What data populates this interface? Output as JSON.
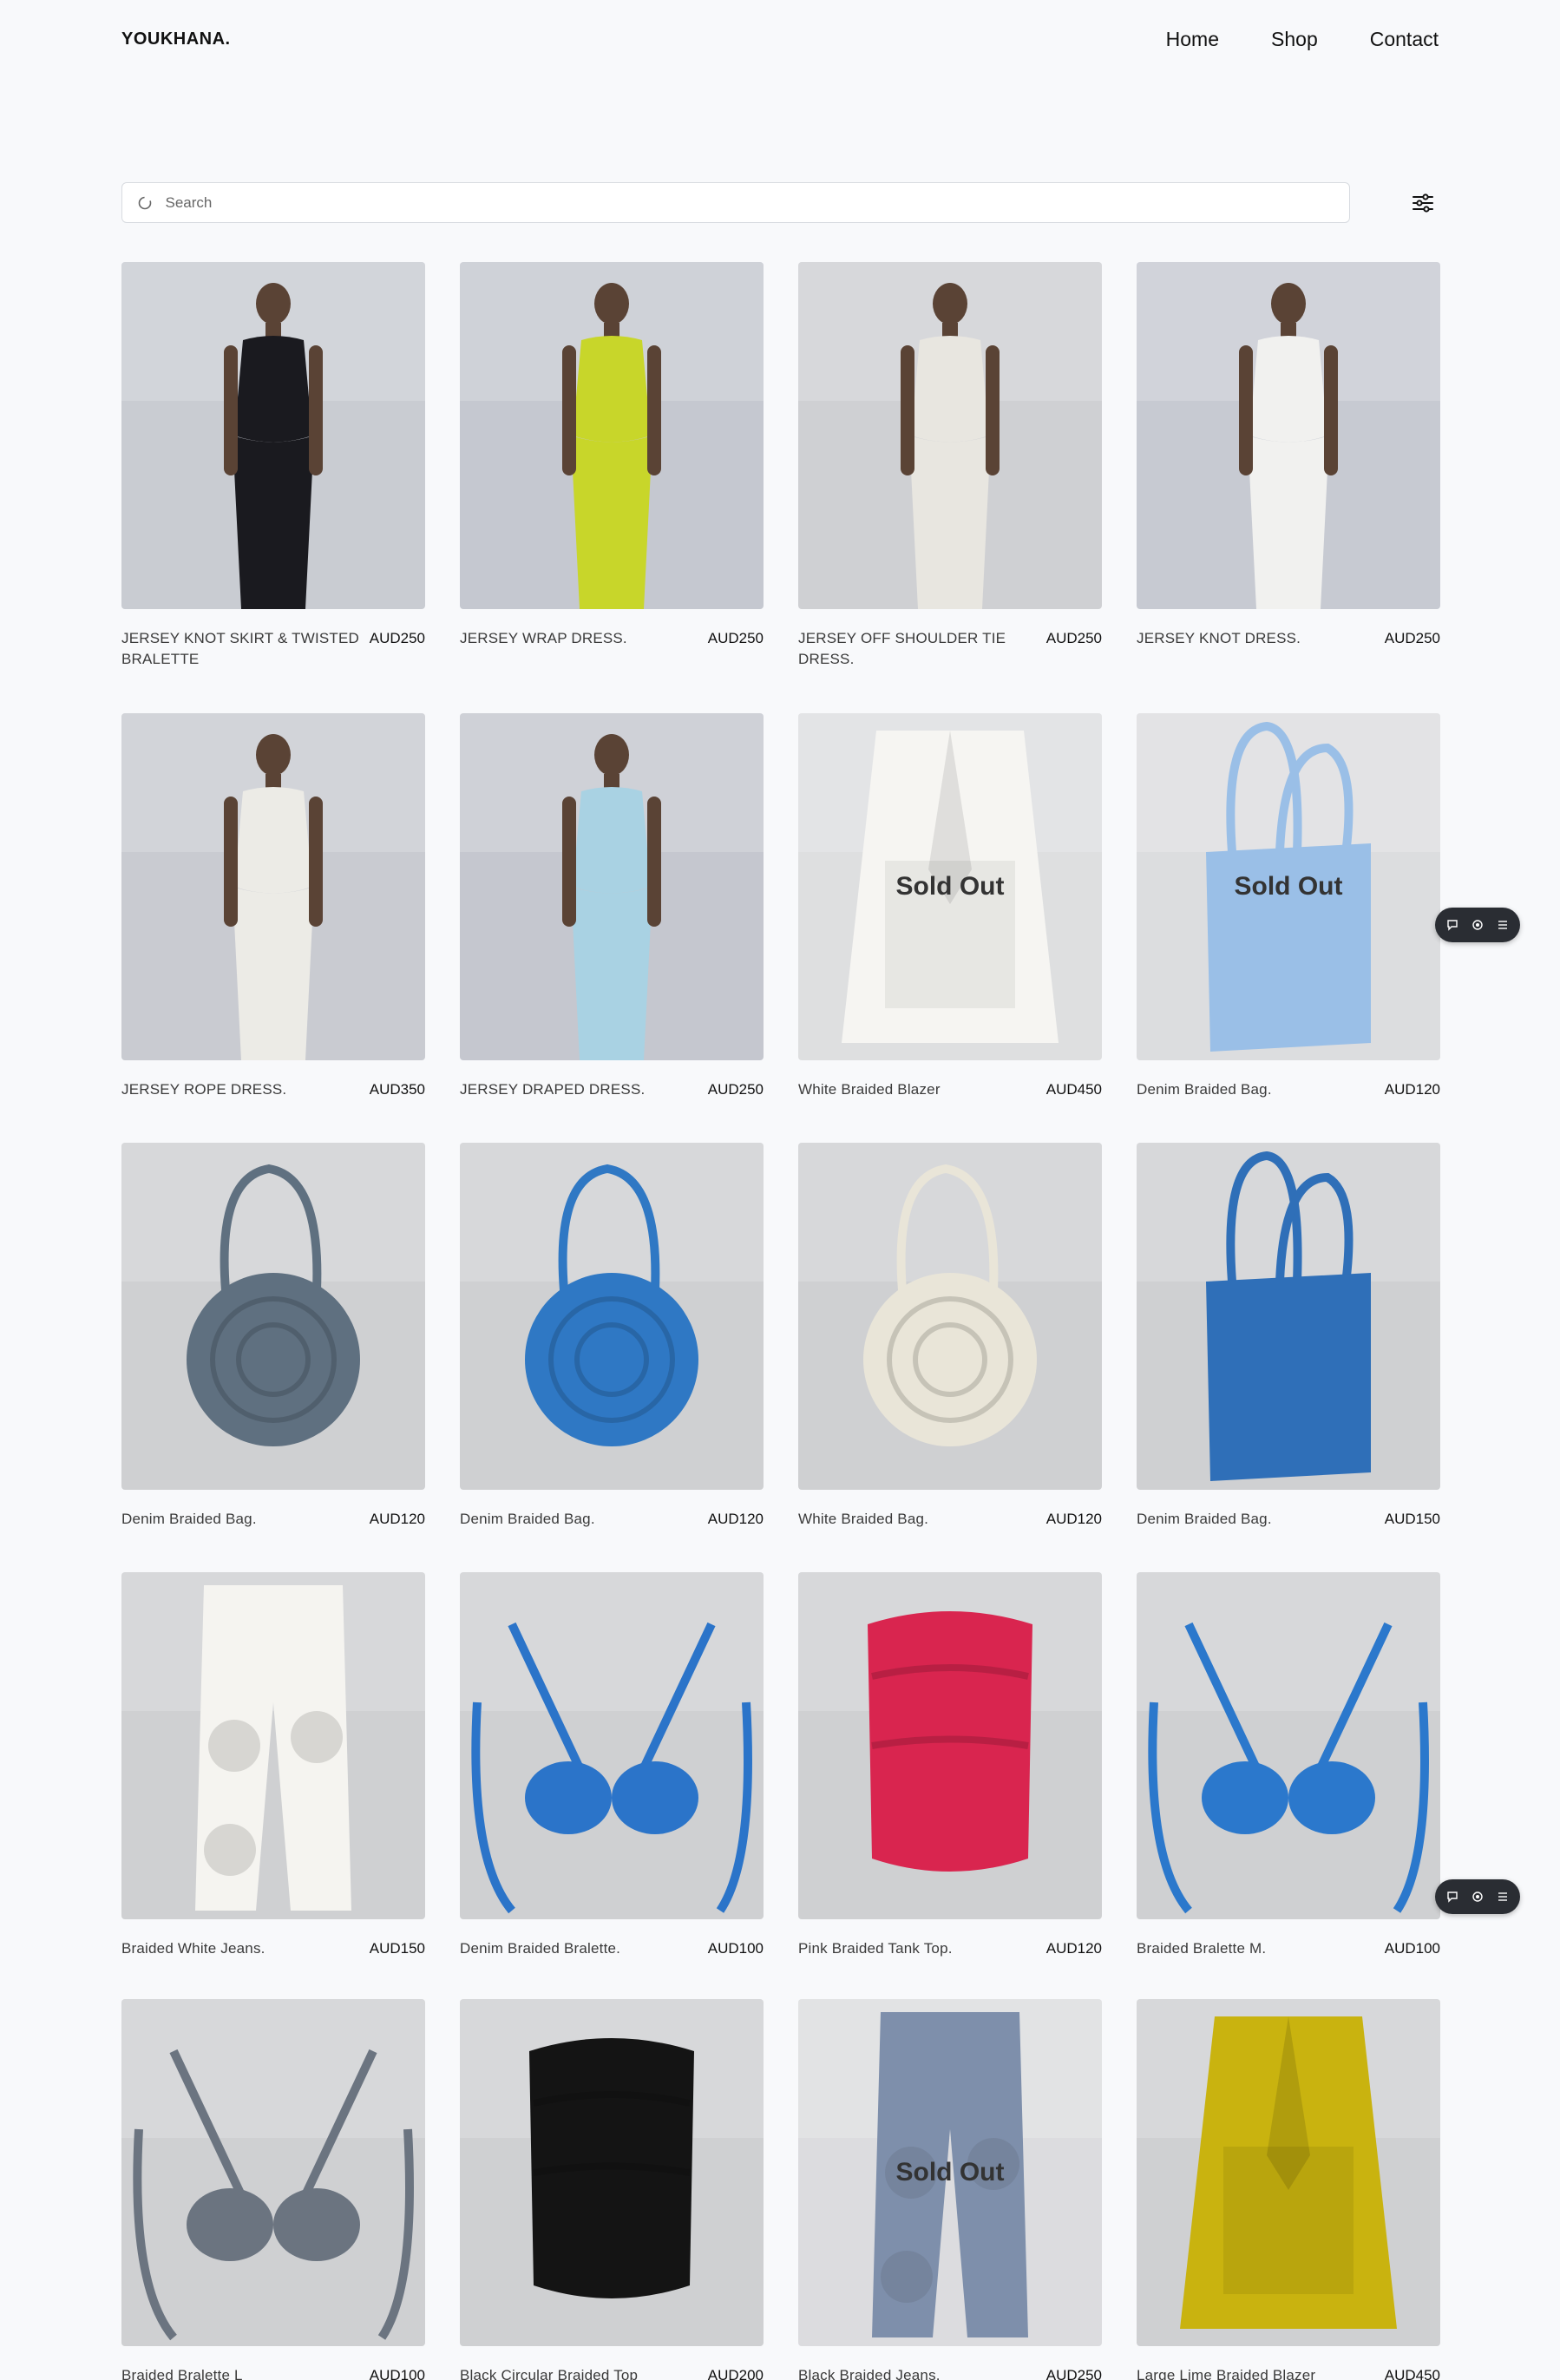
{
  "brand": "YOUKHANA.",
  "nav": [
    "Home",
    "Shop",
    "Contact"
  ],
  "search": {
    "placeholder": "Search"
  },
  "sold_label": "Sold Out",
  "products": [
    {
      "title": "JERSEY KNOT SKIRT & TWISTED BRALETTE",
      "price": "AUD250",
      "sold_out": false,
      "bg": "#c9ccd2",
      "fg": "#1a1a1f",
      "kind": "model"
    },
    {
      "title": "JERSEY WRAP DRESS.",
      "price": "AUD250",
      "sold_out": false,
      "bg": "#c5c8d0",
      "fg": "#c8d62a",
      "kind": "model"
    },
    {
      "title": "JERSEY OFF SHOULDER TIE DRESS.",
      "price": "AUD250",
      "sold_out": false,
      "bg": "#cfd0d3",
      "fg": "#e8e6e0",
      "kind": "model"
    },
    {
      "title": "JERSEY KNOT DRESS.",
      "price": "AUD250",
      "sold_out": false,
      "bg": "#c7cad2",
      "fg": "#f1f1ef",
      "kind": "model"
    },
    {
      "title": "JERSEY ROPE DRESS.",
      "price": "AUD350",
      "sold_out": false,
      "bg": "#c9cbd1",
      "fg": "#ecebe6",
      "kind": "model"
    },
    {
      "title": "JERSEY DRAPED DRESS.",
      "price": "AUD250",
      "sold_out": false,
      "bg": "#c5c7cf",
      "fg": "#a9d2e3",
      "kind": "model"
    },
    {
      "title": "White Braided Blazer",
      "price": "AUD450",
      "sold_out": true,
      "bg": "#d5d6d8",
      "fg": "#f4f3ef",
      "kind": "blazer"
    },
    {
      "title": "Denim Braided Bag.",
      "price": "AUD120",
      "sold_out": true,
      "bg": "#d3d4d7",
      "fg": "#7eaee0",
      "kind": "tote"
    },
    {
      "title": "Denim Braided Bag.",
      "price": "AUD120",
      "sold_out": false,
      "bg": "#cfd0d2",
      "fg": "#5f7080",
      "kind": "round"
    },
    {
      "title": "Denim Braided Bag.",
      "price": "AUD120",
      "sold_out": false,
      "bg": "#cfd0d2",
      "fg": "#2f78c4",
      "kind": "round"
    },
    {
      "title": "White Braided Bag.",
      "price": "AUD120",
      "sold_out": false,
      "bg": "#cfd0d2",
      "fg": "#e9e5d8",
      "kind": "round"
    },
    {
      "title": "Denim Braided Bag.",
      "price": "AUD150",
      "sold_out": false,
      "bg": "#cfd0d2",
      "fg": "#2f6fb8",
      "kind": "tote"
    },
    {
      "title": "Braided White Jeans.",
      "price": "AUD150",
      "sold_out": false,
      "bg": "#cfd0d2",
      "fg": "#f5f4f0",
      "kind": "jeans"
    },
    {
      "title": "Denim Braided Bralette.",
      "price": "AUD100",
      "sold_out": false,
      "bg": "#cfd0d2",
      "fg": "#2b74c9",
      "kind": "bralette"
    },
    {
      "title": "Pink Braided Tank Top.",
      "price": "AUD120",
      "sold_out": false,
      "bg": "#cfd0d2",
      "fg": "#d9254f",
      "kind": "top"
    },
    {
      "title": "Braided Bralette M.",
      "price": "AUD100",
      "sold_out": false,
      "bg": "#cfd0d2",
      "fg": "#2b78cc",
      "kind": "bralette"
    },
    {
      "title": "Braided Bralette L",
      "price": "AUD100",
      "sold_out": false,
      "bg": "#cfd0d2",
      "fg": "#6b7480",
      "kind": "bralette"
    },
    {
      "title": "Black Circular Braided Top",
      "price": "AUD200",
      "sold_out": false,
      "bg": "#cfd0d2",
      "fg": "#141414",
      "kind": "top"
    },
    {
      "title": "Black Braided Jeans.",
      "price": "AUD250",
      "sold_out": true,
      "bg": "#d2d3d6",
      "fg": "#5a7094",
      "kind": "jeans"
    },
    {
      "title": "Large Lime Braided Blazer",
      "price": "AUD450",
      "sold_out": false,
      "bg": "#cfd0d2",
      "fg": "#c9b30f",
      "kind": "blazer"
    }
  ]
}
